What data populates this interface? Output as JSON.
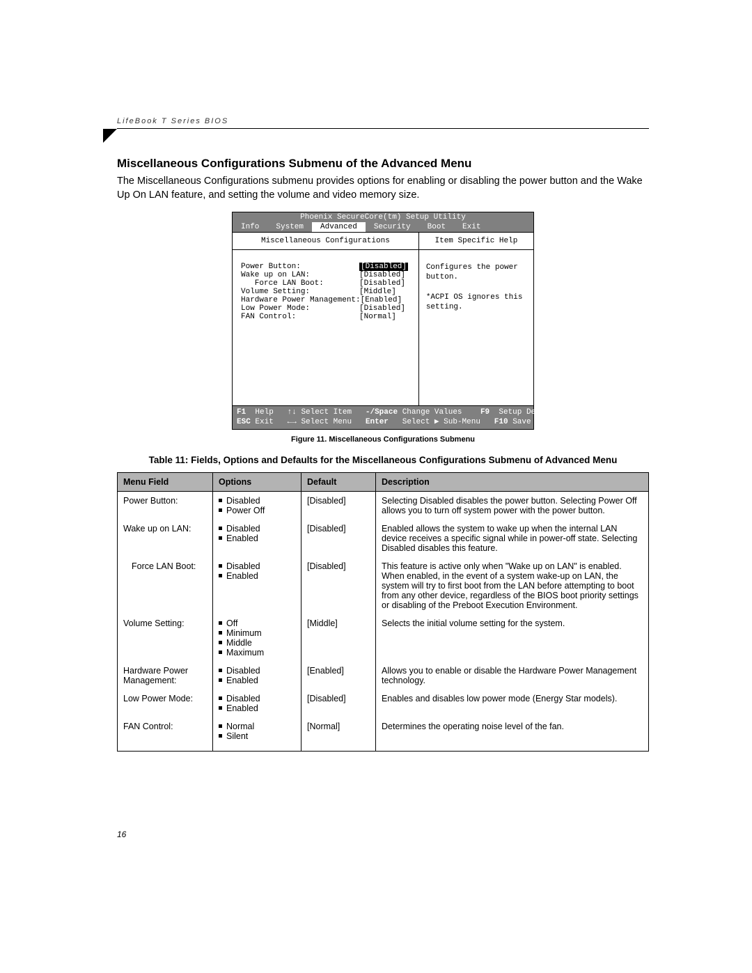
{
  "header": {
    "running_head": "LifeBook T Series BIOS"
  },
  "section": {
    "heading": "Miscellaneous Configurations Submenu of the Advanced Menu",
    "intro": "The Miscellaneous Configurations submenu provides options for enabling or disabling the power button and the Wake Up On LAN feature, and setting the volume and video memory size."
  },
  "bios": {
    "title": "Phoenix SecureCore(tm) Setup Utility",
    "menu": [
      "Info",
      "System",
      "Advanced",
      "Security",
      "Boot",
      "Exit"
    ],
    "menu_selected": "Advanced",
    "left_heading": "Miscellaneous Configurations",
    "right_heading": "Item Specific Help",
    "items": [
      {
        "label": "Power Button:",
        "value": "[Disabled]",
        "highlight": true,
        "indent": 0
      },
      {
        "label": "Wake up on LAN:",
        "value": "[Disabled]",
        "highlight": false,
        "indent": 0
      },
      {
        "label": "Force LAN Boot:",
        "value": "[Disabled]",
        "highlight": false,
        "indent": 1
      },
      {
        "label": "Volume Setting:",
        "value": "[Middle]",
        "highlight": false,
        "indent": 0
      },
      {
        "label": "Hardware Power Management:",
        "value": "[Enabled]",
        "highlight": false,
        "indent": 0
      },
      {
        "label": "Low Power Mode:",
        "value": "[Disabled]",
        "highlight": false,
        "indent": 0
      },
      {
        "label": "FAN Control:",
        "value": "[Normal]",
        "highlight": false,
        "indent": 0
      }
    ],
    "help_text": "Configures the power button.\n\n*ACPI OS ignores this setting.",
    "footer": {
      "l1": {
        "k1": "F1",
        "t1": "Help",
        "k2": "↑↓",
        "t2": "Select Item",
        "k3": "-/Space",
        "t3": "Change Values",
        "k4": "F9",
        "t4": "Setup Defaults"
      },
      "l2": {
        "k1": "ESC",
        "t1": "Exit",
        "k2": "←→",
        "t2": "Select Menu",
        "k3": "Enter",
        "t3": "Select ▶ Sub-Menu",
        "k4": "F10",
        "t4": "Save and Exit"
      }
    }
  },
  "figure_caption": "Figure 11.  Miscellaneous Configurations Submenu",
  "table": {
    "title": "Table 11: Fields, Options and Defaults for the Miscellaneous Configurations Submenu of Advanced Menu",
    "headers": {
      "c1": "Menu Field",
      "c2": "Options",
      "c3": "Default",
      "c4": "Description"
    },
    "rows": [
      {
        "field": "Power Button:",
        "options": [
          "Disabled",
          "Power Off"
        ],
        "default": "[Disabled]",
        "desc": "Selecting Disabled disables the power button. Selecting Power Off allows you to turn off system power with the power button.",
        "indent": false
      },
      {
        "field": "Wake up on LAN:",
        "options": [
          "Disabled",
          "Enabled"
        ],
        "default": "[Disabled]",
        "desc": "Enabled allows the system to wake up when the internal LAN device receives a specific signal while in power-off state. Selecting Disabled disables this feature.",
        "indent": false
      },
      {
        "field": "Force LAN Boot:",
        "options": [
          "Disabled",
          "Enabled"
        ],
        "default": "[Disabled]",
        "desc": "This feature is active only when \"Wake up on LAN\" is enabled. When enabled, in the event of a system wake-up on LAN, the system will try to first boot from the LAN before attempting to boot from any other device, regardless of the BIOS boot priority settings or disabling of the Preboot Execution Environment.",
        "indent": true
      },
      {
        "field": "Volume Setting:",
        "options": [
          "Off",
          "Minimum",
          "Middle",
          "Maximum"
        ],
        "default": "[Middle]",
        "desc": "Selects the initial volume setting for the system.",
        "indent": false
      },
      {
        "field": "Hardware Power Management:",
        "options": [
          "Disabled",
          "Enabled"
        ],
        "default": "[Enabled]",
        "desc": "Allows you to enable or disable the Hardware Power Management technology.",
        "indent": false
      },
      {
        "field": "Low Power Mode:",
        "options": [
          "Disabled",
          "Enabled"
        ],
        "default": "[Disabled]",
        "desc": "Enables and disables low power mode (Energy Star models).",
        "indent": false
      },
      {
        "field": "FAN Control:",
        "options": [
          "Normal",
          "Silent"
        ],
        "default": "[Normal]",
        "desc": "Determines the operating noise level of the fan.",
        "indent": false
      }
    ]
  },
  "page_number": "16"
}
